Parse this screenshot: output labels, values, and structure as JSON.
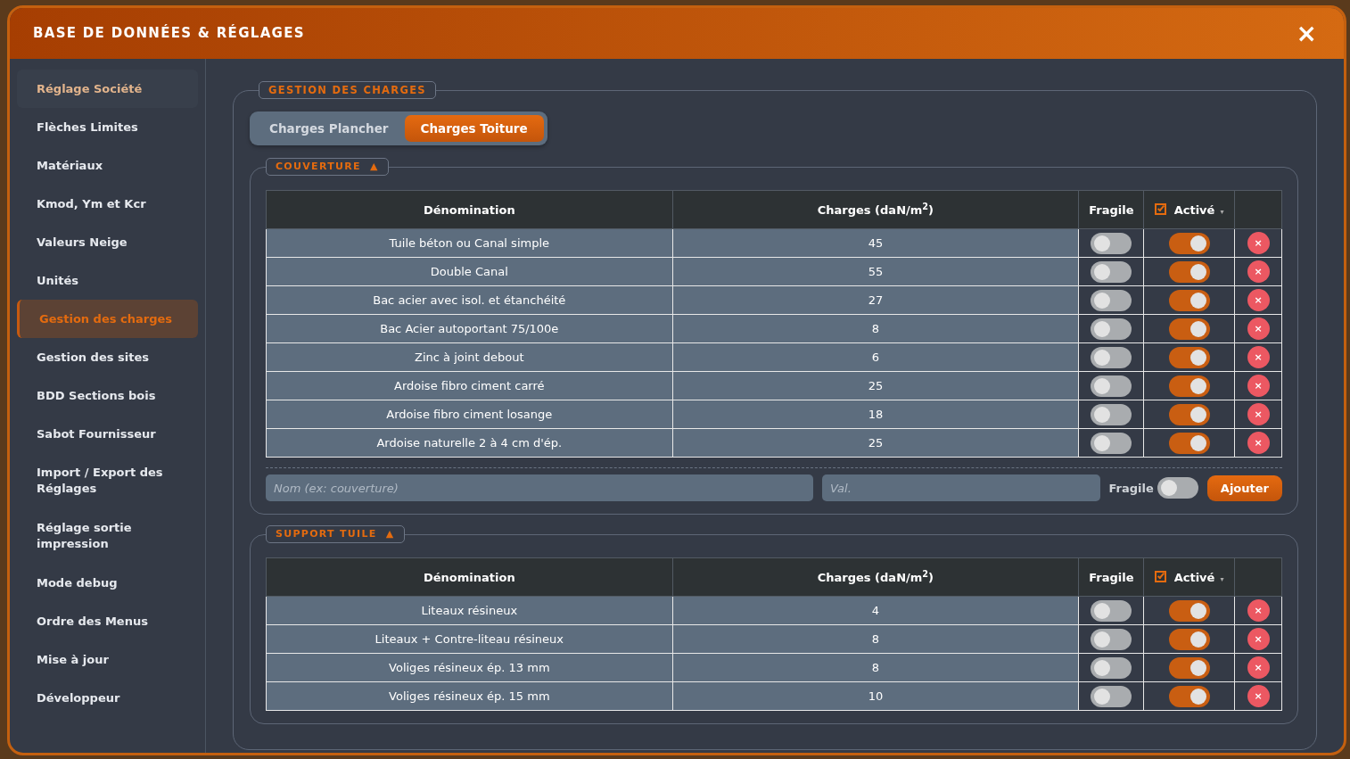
{
  "window": {
    "title": "BASE DE DONNÉES & RÉGLAGES",
    "close": "×"
  },
  "sidebar": {
    "items": [
      {
        "label": "Réglage Société",
        "selected": false,
        "hovered": true
      },
      {
        "label": "Flèches Limites",
        "selected": false,
        "hovered": false
      },
      {
        "label": "Matériaux",
        "selected": false,
        "hovered": false
      },
      {
        "label": "Kmod, Ym et Kcr",
        "selected": false,
        "hovered": false
      },
      {
        "label": "Valeurs Neige",
        "selected": false,
        "hovered": false
      },
      {
        "label": "Unités",
        "selected": false,
        "hovered": false
      },
      {
        "label": "Gestion des charges",
        "selected": true,
        "hovered": false
      },
      {
        "label": "Gestion des sites",
        "selected": false,
        "hovered": false
      },
      {
        "label": "BDD Sections bois",
        "selected": false,
        "hovered": false
      },
      {
        "label": "Sabot Fournisseur",
        "selected": false,
        "hovered": false
      },
      {
        "label": "Import / Export des Réglages",
        "selected": false,
        "hovered": false
      },
      {
        "label": "Réglage sortie impression",
        "selected": false,
        "hovered": false
      },
      {
        "label": "Mode debug",
        "selected": false,
        "hovered": false
      },
      {
        "label": "Ordre des Menus",
        "selected": false,
        "hovered": false
      },
      {
        "label": "Mise à jour",
        "selected": false,
        "hovered": false
      },
      {
        "label": "Développeur",
        "selected": false,
        "hovered": false
      }
    ]
  },
  "panel": {
    "title": "GESTION DES CHARGES",
    "tabs": [
      {
        "label": "Charges Plancher",
        "selected": false
      },
      {
        "label": "Charges Toiture",
        "selected": true
      }
    ],
    "sections": [
      {
        "title": "COUVERTURE",
        "toggle": "▲",
        "columns": [
          {
            "kind": "text",
            "label": "Dénomination"
          },
          {
            "kind": "text",
            "label": "Charges (daN/m$^{2}$)"
          },
          {
            "kind": "text",
            "label": "Fragile"
          },
          {
            "kind": "checkbox-menu",
            "label": "Activé",
            "checked": true,
            "caret": "▾"
          },
          {
            "kind": "empty"
          }
        ],
        "rows": [
          {
            "name": "Tuile béton ou Canal simple",
            "value": "45",
            "fragile": false,
            "active": true,
            "delete": "×"
          },
          {
            "name": "Double Canal",
            "value": "55",
            "fragile": false,
            "active": true,
            "delete": "×"
          },
          {
            "name": "Bac acier avec isol. et étanchéité",
            "value": "27",
            "fragile": false,
            "active": true,
            "delete": "×"
          },
          {
            "name": "Bac Acier autoportant 75/100e",
            "value": "8",
            "fragile": false,
            "active": true,
            "delete": "×"
          },
          {
            "name": "Zinc à joint debout",
            "value": "6",
            "fragile": false,
            "active": true,
            "delete": "×"
          },
          {
            "name": "Ardoise fibro ciment carré",
            "value": "25",
            "fragile": false,
            "active": true,
            "delete": "×"
          },
          {
            "name": "Ardoise fibro ciment losange",
            "value": "18",
            "fragile": false,
            "active": true,
            "delete": "×"
          },
          {
            "name": "Ardoise naturelle 2 à 4 cm d'ép.",
            "value": "25",
            "fragile": false,
            "active": true,
            "delete": "×"
          }
        ],
        "add_form": {
          "name_placeholder": "Nom (ex: couverture)",
          "value_placeholder": "Val.",
          "fragile_label": "Fragile",
          "fragile": false,
          "button": "Ajouter"
        }
      },
      {
        "title": "SUPPORT TUILE",
        "toggle": "▲",
        "columns": [
          {
            "kind": "text",
            "label": "Dénomination"
          },
          {
            "kind": "text",
            "label": "Charges (daN/m$^{2}$)"
          },
          {
            "kind": "text",
            "label": "Fragile"
          },
          {
            "kind": "checkbox-menu",
            "label": "Activé",
            "checked": true,
            "caret": "▾"
          },
          {
            "kind": "empty"
          }
        ],
        "rows": [
          {
            "name": "Liteaux résineux",
            "value": "4",
            "fragile": false,
            "active": true,
            "delete": "×"
          },
          {
            "name": "Liteaux + Contre-liteau résineux",
            "value": "8",
            "fragile": false,
            "active": true,
            "delete": "×"
          },
          {
            "name": "Voliges résineux ép. 13 mm",
            "value": "8",
            "fragile": false,
            "active": true,
            "delete": "×"
          },
          {
            "name": "Voliges résineux ép. 15 mm",
            "value": "10",
            "fragile": false,
            "active": true,
            "delete": "×"
          }
        ]
      }
    ]
  }
}
